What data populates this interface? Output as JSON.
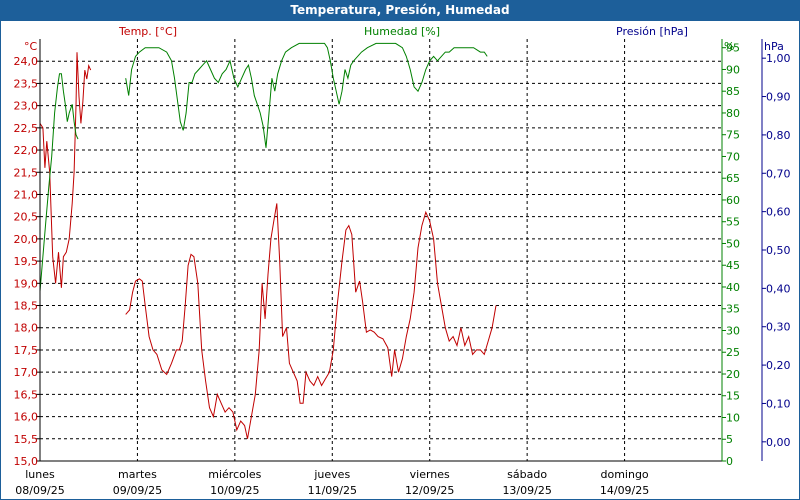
{
  "window": {
    "title": "Temperatura, Presión, Humedad"
  },
  "colors": {
    "titlebar": "#1d5f9a",
    "temperature": "#c00000",
    "humidity": "#008000",
    "pressure": "#00008b"
  },
  "chart_data": {
    "type": "line",
    "title": "Temperatura, Presión, Humedad",
    "grid": true,
    "legend": "none",
    "axes": {
      "temperature": {
        "label": "Temp. [°C]",
        "unit": "°C",
        "side": "left",
        "range": [
          15.0,
          24.5
        ],
        "ticks": [
          "15,0",
          "15,5",
          "16,0",
          "16,5",
          "17,0",
          "17,5",
          "18,0",
          "18,5",
          "19,0",
          "19,5",
          "20,0",
          "20,5",
          "21,0",
          "21,5",
          "22,0",
          "22,5",
          "23,0",
          "23,5",
          "24,0"
        ]
      },
      "humidity": {
        "label": "Humedad [%]",
        "unit": "%",
        "side": "right-inner",
        "range": [
          0,
          97
        ],
        "ticks": [
          "0",
          "5",
          "10",
          "15",
          "20",
          "25",
          "30",
          "35",
          "40",
          "45",
          "50",
          "55",
          "60",
          "65",
          "70",
          "75",
          "80",
          "85",
          "90",
          "95"
        ]
      },
      "pressure": {
        "label": "Presión [hPa]",
        "unit": "hPa",
        "side": "right-outer",
        "range": [
          -0.05,
          1.05
        ],
        "ticks": [
          "0,00",
          "0,10",
          "0,20",
          "0,30",
          "0,40",
          "0,50",
          "0,60",
          "0,70",
          "0,80",
          "0,90",
          "1,00"
        ]
      },
      "time": {
        "range_days": [
          0,
          7
        ],
        "days": [
          {
            "name": "lunes",
            "date": "08/09/25"
          },
          {
            "name": "martes",
            "date": "09/09/25"
          },
          {
            "name": "miércoles",
            "date": "10/09/25"
          },
          {
            "name": "jueves",
            "date": "11/09/25"
          },
          {
            "name": "viernes",
            "date": "12/09/25"
          },
          {
            "name": "sábado",
            "date": "13/09/25"
          },
          {
            "name": "domingo",
            "date": "14/09/25"
          }
        ]
      }
    },
    "series": [
      {
        "name": "Temp. [°C]",
        "axis": "temperature",
        "color": "#c00000",
        "segments": [
          [
            [
              0.0,
              22.6
            ],
            [
              0.03,
              22.5
            ],
            [
              0.05,
              21.6
            ],
            [
              0.07,
              22.2
            ],
            [
              0.1,
              21.5
            ],
            [
              0.13,
              19.6
            ],
            [
              0.16,
              19.0
            ],
            [
              0.19,
              19.7
            ],
            [
              0.22,
              18.9
            ],
            [
              0.24,
              19.6
            ],
            [
              0.27,
              19.7
            ],
            [
              0.3,
              20.0
            ],
            [
              0.33,
              20.8
            ],
            [
              0.35,
              21.5
            ],
            [
              0.37,
              23.0
            ],
            [
              0.38,
              24.2
            ],
            [
              0.4,
              23.2
            ],
            [
              0.42,
              22.6
            ],
            [
              0.44,
              23.1
            ],
            [
              0.46,
              23.8
            ],
            [
              0.48,
              23.6
            ],
            [
              0.5,
              23.9
            ],
            [
              0.52,
              23.8
            ]
          ],
          [
            [
              0.88,
              18.3
            ],
            [
              0.92,
              18.4
            ],
            [
              0.95,
              18.8
            ],
            [
              0.98,
              19.05
            ],
            [
              1.02,
              19.1
            ],
            [
              1.05,
              19.05
            ],
            [
              1.08,
              18.5
            ],
            [
              1.12,
              17.8
            ],
            [
              1.16,
              17.5
            ],
            [
              1.2,
              17.4
            ],
            [
              1.25,
              17.05
            ],
            [
              1.3,
              16.95
            ],
            [
              1.35,
              17.2
            ],
            [
              1.4,
              17.5
            ],
            [
              1.43,
              17.5
            ],
            [
              1.46,
              17.7
            ],
            [
              1.49,
              18.5
            ],
            [
              1.52,
              19.4
            ],
            [
              1.55,
              19.65
            ],
            [
              1.58,
              19.6
            ],
            [
              1.62,
              19.0
            ],
            [
              1.66,
              17.5
            ],
            [
              1.7,
              16.8
            ],
            [
              1.74,
              16.2
            ],
            [
              1.78,
              16.0
            ],
            [
              1.82,
              16.5
            ],
            [
              1.86,
              16.3
            ],
            [
              1.9,
              16.1
            ],
            [
              1.94,
              16.2
            ],
            [
              1.98,
              16.1
            ],
            [
              2.02,
              15.7
            ],
            [
              2.06,
              15.9
            ],
            [
              2.1,
              15.8
            ],
            [
              2.13,
              15.5
            ],
            [
              2.17,
              16.0
            ],
            [
              2.21,
              16.5
            ],
            [
              2.25,
              17.5
            ],
            [
              2.28,
              19.0
            ],
            [
              2.31,
              18.2
            ],
            [
              2.34,
              19.2
            ],
            [
              2.37,
              20.0
            ],
            [
              2.4,
              20.4
            ],
            [
              2.43,
              20.8
            ],
            [
              2.46,
              19.5
            ],
            [
              2.49,
              17.8
            ],
            [
              2.53,
              18.0
            ],
            [
              2.56,
              17.2
            ],
            [
              2.6,
              17.0
            ],
            [
              2.64,
              16.8
            ],
            [
              2.67,
              16.3
            ],
            [
              2.7,
              16.3
            ],
            [
              2.73,
              17.0
            ],
            [
              2.77,
              16.8
            ],
            [
              2.81,
              16.7
            ],
            [
              2.85,
              16.9
            ],
            [
              2.89,
              16.7
            ],
            [
              2.93,
              16.85
            ],
            [
              2.97,
              17.0
            ],
            [
              3.01,
              17.5
            ],
            [
              3.05,
              18.5
            ],
            [
              3.1,
              19.5
            ],
            [
              3.14,
              20.2
            ],
            [
              3.17,
              20.3
            ],
            [
              3.2,
              20.1
            ],
            [
              3.24,
              18.8
            ],
            [
              3.28,
              19.05
            ],
            [
              3.31,
              18.6
            ],
            [
              3.35,
              17.9
            ],
            [
              3.39,
              17.95
            ],
            [
              3.43,
              17.9
            ],
            [
              3.47,
              17.8
            ],
            [
              3.52,
              17.75
            ],
            [
              3.57,
              17.55
            ],
            [
              3.61,
              16.9
            ],
            [
              3.64,
              17.5
            ],
            [
              3.68,
              17.0
            ],
            [
              3.72,
              17.3
            ],
            [
              3.76,
              17.8
            ],
            [
              3.8,
              18.2
            ],
            [
              3.84,
              18.8
            ],
            [
              3.88,
              19.8
            ],
            [
              3.92,
              20.3
            ],
            [
              3.96,
              20.6
            ],
            [
              4.0,
              20.4
            ],
            [
              4.04,
              20.0
            ],
            [
              4.08,
              19.0
            ],
            [
              4.12,
              18.5
            ],
            [
              4.16,
              18.0
            ],
            [
              4.2,
              17.7
            ],
            [
              4.24,
              17.8
            ],
            [
              4.28,
              17.6
            ],
            [
              4.32,
              18.0
            ],
            [
              4.36,
              17.6
            ],
            [
              4.4,
              17.8
            ],
            [
              4.44,
              17.4
            ],
            [
              4.48,
              17.5
            ],
            [
              4.52,
              17.5
            ],
            [
              4.56,
              17.4
            ],
            [
              4.6,
              17.7
            ],
            [
              4.64,
              18.0
            ],
            [
              4.68,
              18.5
            ]
          ]
        ]
      },
      {
        "name": "Humedad [%]",
        "axis": "humidity",
        "color": "#008000",
        "segments": [
          [
            [
              0.0,
              39
            ],
            [
              0.03,
              47
            ],
            [
              0.06,
              55
            ],
            [
              0.09,
              63
            ],
            [
              0.12,
              70
            ],
            [
              0.15,
              80
            ],
            [
              0.18,
              86
            ],
            [
              0.2,
              89
            ],
            [
              0.22,
              89
            ],
            [
              0.24,
              85
            ],
            [
              0.26,
              82
            ],
            [
              0.28,
              78
            ],
            [
              0.3,
              80
            ],
            [
              0.33,
              82
            ],
            [
              0.35,
              78
            ],
            [
              0.37,
              75
            ],
            [
              0.39,
              74
            ]
          ],
          [
            [
              0.88,
              88
            ],
            [
              0.91,
              84
            ],
            [
              0.94,
              90
            ],
            [
              0.98,
              93
            ],
            [
              1.02,
              94
            ],
            [
              1.08,
              95
            ],
            [
              1.15,
              95
            ],
            [
              1.22,
              95
            ],
            [
              1.3,
              94
            ],
            [
              1.35,
              92
            ],
            [
              1.38,
              88
            ],
            [
              1.41,
              83
            ],
            [
              1.44,
              78
            ],
            [
              1.47,
              76
            ],
            [
              1.5,
              80
            ],
            [
              1.53,
              87
            ],
            [
              1.56,
              87
            ],
            [
              1.59,
              89
            ],
            [
              1.63,
              90
            ],
            [
              1.67,
              91
            ],
            [
              1.71,
              92
            ],
            [
              1.75,
              90
            ],
            [
              1.79,
              88
            ],
            [
              1.83,
              87
            ],
            [
              1.87,
              89
            ],
            [
              1.91,
              90
            ],
            [
              1.95,
              92
            ],
            [
              1.99,
              88
            ],
            [
              2.03,
              86
            ],
            [
              2.07,
              88
            ],
            [
              2.11,
              90
            ],
            [
              2.14,
              91
            ],
            [
              2.17,
              88
            ],
            [
              2.2,
              84
            ],
            [
              2.23,
              82
            ],
            [
              2.26,
              80
            ],
            [
              2.29,
              77
            ],
            [
              2.32,
              72
            ],
            [
              2.35,
              80
            ],
            [
              2.38,
              88
            ],
            [
              2.41,
              85
            ],
            [
              2.44,
              89
            ],
            [
              2.48,
              92
            ],
            [
              2.52,
              94
            ],
            [
              2.58,
              95
            ],
            [
              2.66,
              96
            ],
            [
              2.75,
              96
            ],
            [
              2.85,
              96
            ],
            [
              2.92,
              96
            ],
            [
              2.95,
              95
            ],
            [
              2.98,
              92
            ],
            [
              3.01,
              88
            ],
            [
              3.04,
              85
            ],
            [
              3.07,
              82
            ],
            [
              3.1,
              85
            ],
            [
              3.13,
              90
            ],
            [
              3.16,
              88
            ],
            [
              3.19,
              91
            ],
            [
              3.22,
              92
            ],
            [
              3.26,
              93
            ],
            [
              3.3,
              94
            ],
            [
              3.36,
              95
            ],
            [
              3.45,
              96
            ],
            [
              3.55,
              96
            ],
            [
              3.65,
              96
            ],
            [
              3.72,
              95
            ],
            [
              3.76,
              93
            ],
            [
              3.8,
              90
            ],
            [
              3.84,
              86
            ],
            [
              3.88,
              85
            ],
            [
              3.92,
              87
            ],
            [
              3.96,
              90
            ],
            [
              4.0,
              92
            ],
            [
              4.04,
              93
            ],
            [
              4.08,
              92
            ],
            [
              4.12,
              93
            ],
            [
              4.16,
              94
            ],
            [
              4.2,
              94
            ],
            [
              4.25,
              95
            ],
            [
              4.35,
              95
            ],
            [
              4.45,
              95
            ],
            [
              4.52,
              94
            ],
            [
              4.56,
              94
            ],
            [
              4.59,
              93
            ]
          ]
        ]
      }
    ]
  }
}
